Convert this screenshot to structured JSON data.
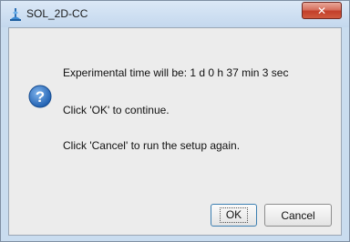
{
  "window": {
    "title": "SOL_2D-CC",
    "close_symbol": "✕",
    "icons": {
      "app": "app-icon",
      "close": "close-icon",
      "message": "question-icon"
    }
  },
  "dialog": {
    "line1": "Experimental time will be: 1 d 0 h 37 min 3 sec",
    "line2": "Click 'OK' to continue.",
    "line3": "Click 'Cancel' to run the setup again."
  },
  "buttons": {
    "ok_label": "OK",
    "cancel_label": "Cancel"
  },
  "colors": {
    "frame": "#c9dcef",
    "content_bg": "#ececec",
    "close_button": "#c33f2a",
    "question_icon": "#1f5fb0"
  }
}
